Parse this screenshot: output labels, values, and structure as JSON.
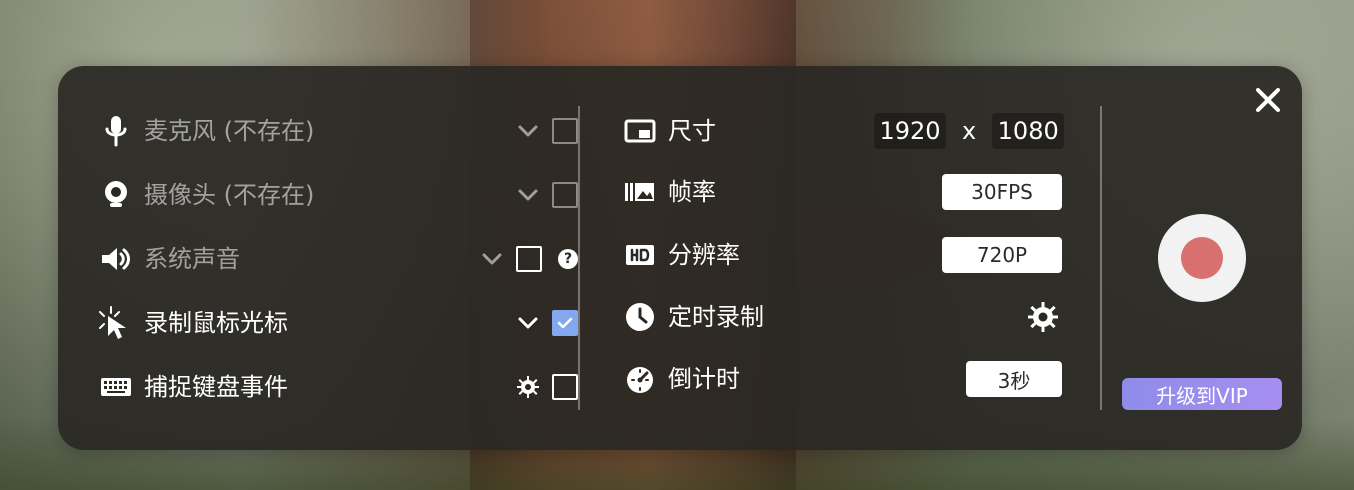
{
  "left_options": [
    {
      "label": "麦克风 (不存在)",
      "icon": "microphone-icon"
    },
    {
      "label": "摄像头 (不存在)",
      "icon": "webcam-icon"
    },
    {
      "label": "系统声音",
      "icon": "speaker-icon",
      "help": "?"
    },
    {
      "label": "录制鼠标光标",
      "icon": "cursor-click-icon"
    },
    {
      "label": "捕捉键盘事件",
      "icon": "keyboard-icon"
    }
  ],
  "settings": {
    "size_label": "尺寸",
    "width": "1920",
    "separator": "x",
    "height": "1080",
    "framerate_label": "帧率",
    "framerate_value": "30FPS",
    "resolution_label": "分辨率",
    "resolution_value": "720P",
    "timer_label": "定时录制",
    "countdown_label": "倒计时",
    "countdown_value": "3秒"
  },
  "actions": {
    "upgrade_label": "升级到VIP"
  },
  "colors": {
    "panel": "#2a2823",
    "checkbox_checked": "#84a8ef",
    "record_dot": "#d97070",
    "vip_start": "#8f8ce9",
    "vip_end": "#a68ef0"
  }
}
